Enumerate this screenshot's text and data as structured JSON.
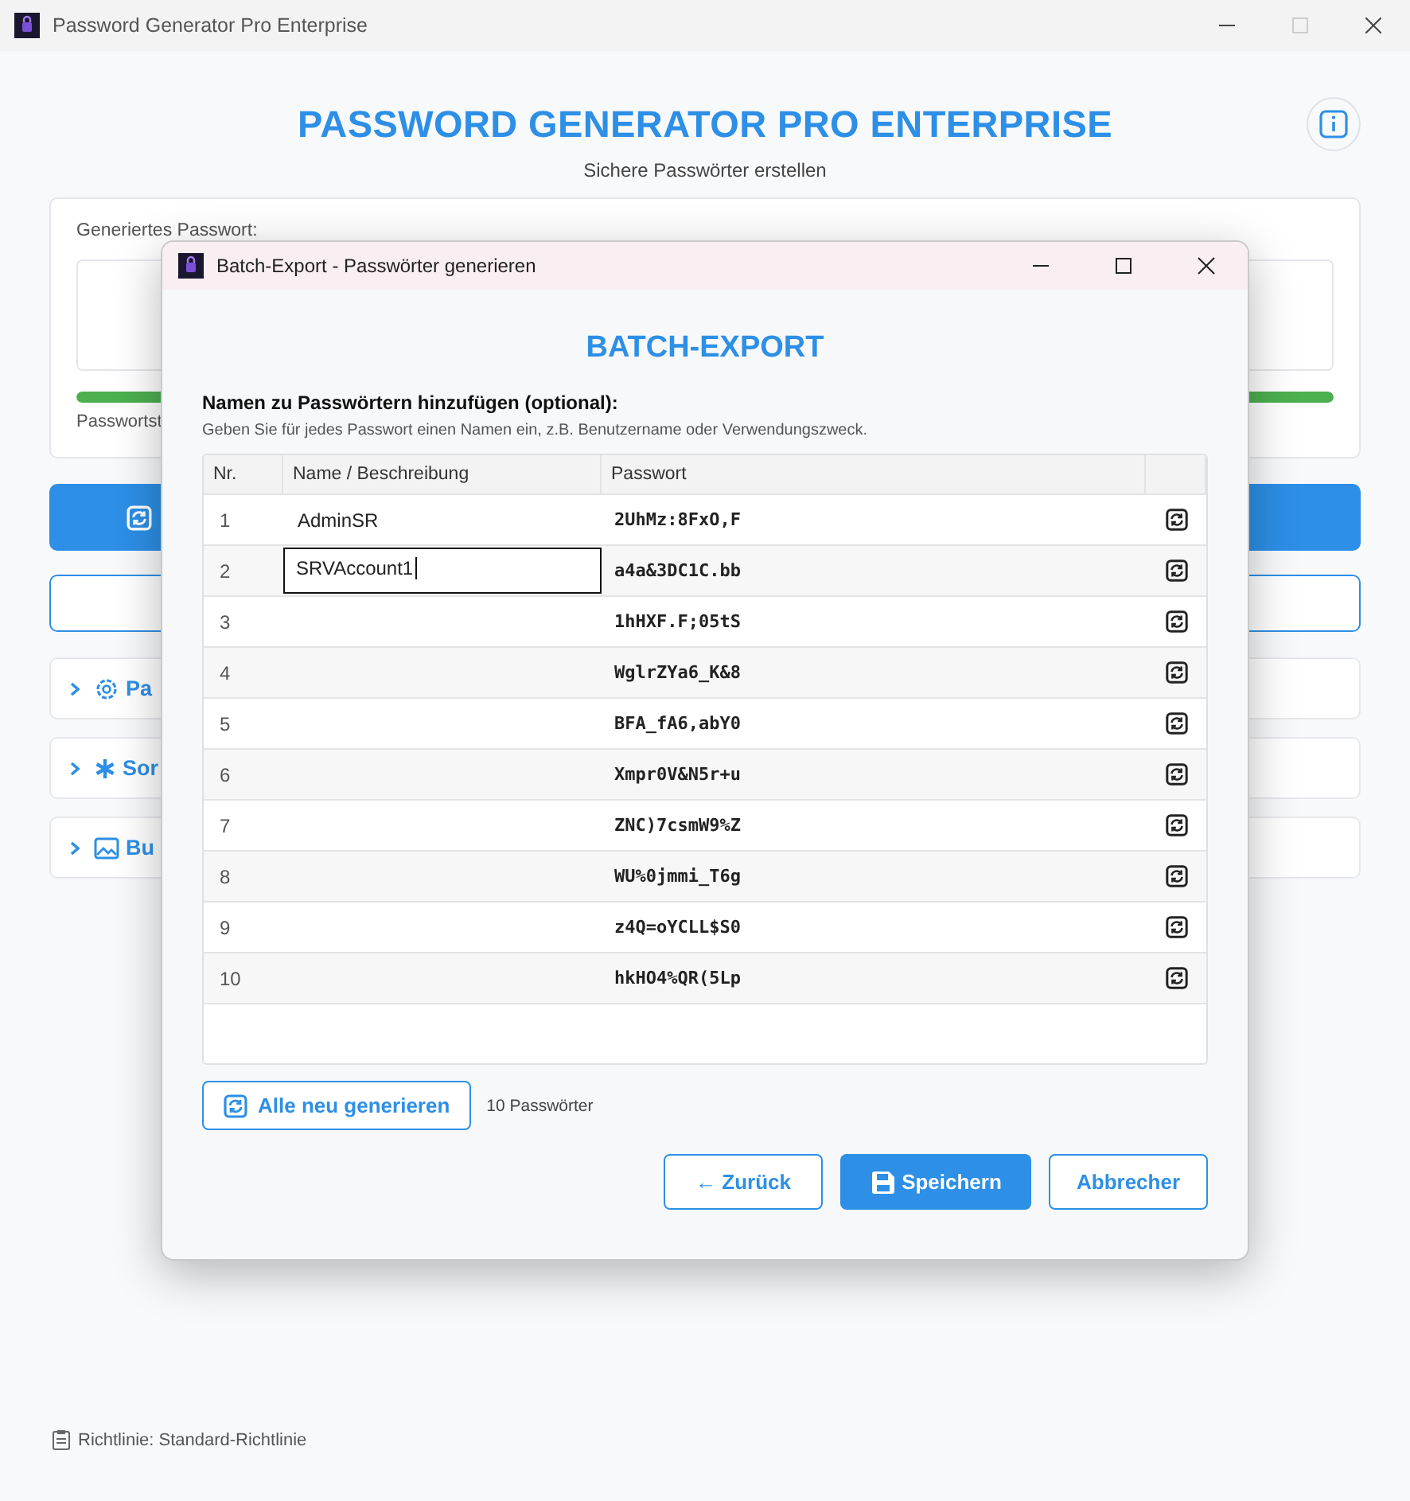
{
  "window": {
    "title": "Password Generator Pro Enterprise"
  },
  "header": {
    "title": "PASSWORD GENERATOR PRO ENTERPRISE",
    "subtitle": "Sichere Passwörter erstellen"
  },
  "password_card": {
    "label": "Generiertes Passwort:",
    "strength": {
      "level": 1.0
    },
    "strength_label": "Passwortst"
  },
  "sections": [
    {
      "label": "Pa",
      "expanded": false
    },
    {
      "label": "Sor",
      "expanded": false
    },
    {
      "label": "Bu",
      "expanded": false
    }
  ],
  "footer": {
    "policy": "Richtlinie: Standard-Richtlinie"
  },
  "dialog": {
    "title": "Batch-Export - Passwörter generieren",
    "heading": "BATCH-EXPORT",
    "instruction": "Namen zu Passwörtern hinzufügen (optional):",
    "hint": "Geben Sie für jedes Passwort einen Namen ein, z.B. Benutzername oder Verwendungszweck.",
    "table": {
      "columns": [
        "Nr.",
        "Name / Beschreibung",
        "Passwort"
      ],
      "rows": [
        {
          "nr": "1",
          "name": "AdminSR",
          "password": "2UhMz:8FxO,F",
          "editing": false
        },
        {
          "nr": "2",
          "name": "SRVAccount1",
          "password": "a4a&3DC1C.bb",
          "editing": true
        },
        {
          "nr": "3",
          "password": "1hHXF.F;05tS",
          "editing": false
        },
        {
          "nr": "4",
          "password": "WglrZYa6_K&8",
          "editing": false
        },
        {
          "nr": "5",
          "password": "BFA_fA6,abY0",
          "editing": false
        },
        {
          "nr": "6",
          "password": "Xmpr0V&N5r+u",
          "editing": false
        },
        {
          "nr": "7",
          "password": "ZNC)7csmW9%Z",
          "editing": false
        },
        {
          "nr": "8",
          "password": "WU%0jmmi_T6g",
          "editing": false
        },
        {
          "nr": "9",
          "password": "z4Q=oYCLL$S0",
          "editing": false
        },
        {
          "nr": "10",
          "password": "hkHO4%QR(5Lp",
          "editing": false
        }
      ]
    },
    "regenerate_all": "Alle neu generieren",
    "count": "10 Passwörter",
    "buttons": [
      {
        "label": "← Zurück",
        "kind": "outline"
      },
      {
        "label": "Speichern",
        "kind": "primary"
      },
      {
        "label": "Abbrecher",
        "kind": "outline"
      }
    ]
  }
}
